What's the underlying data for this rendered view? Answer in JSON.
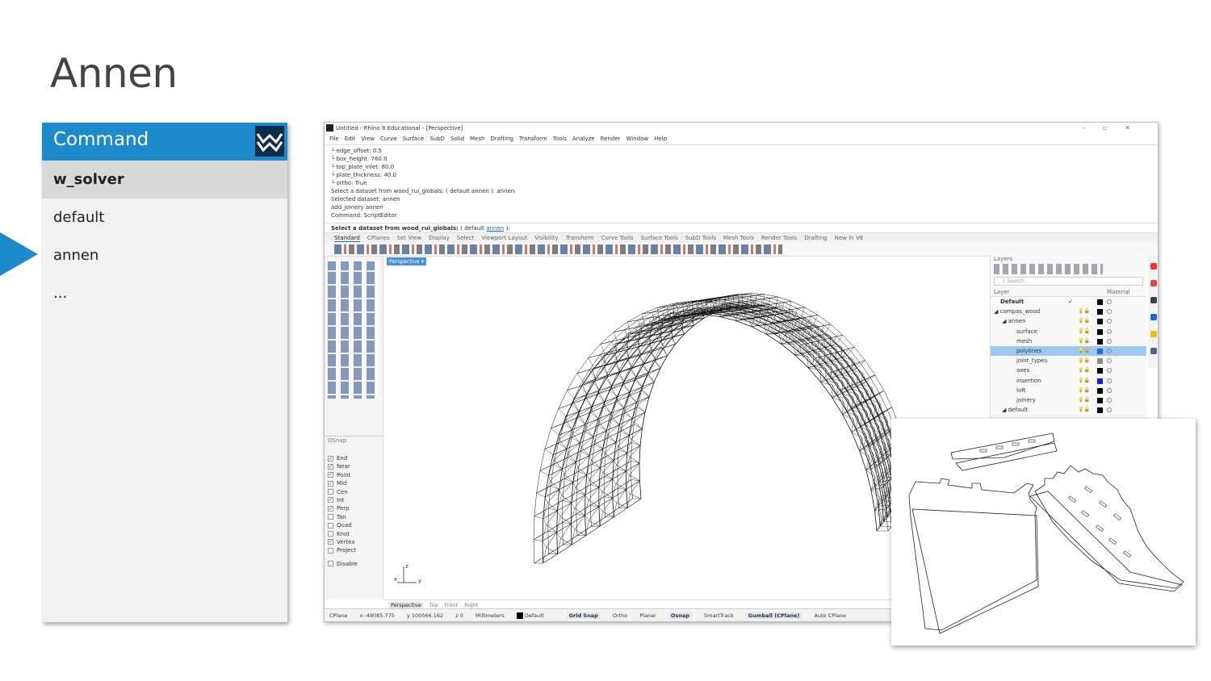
{
  "slide": {
    "title": "Annen"
  },
  "command_panel": {
    "header": "Command",
    "items": [
      "w_solver",
      "default",
      "annen",
      "..."
    ]
  },
  "rhino": {
    "window_title": "Untitled - Rhino 8 Educational - [Perspective]",
    "menu": [
      "File",
      "Edit",
      "View",
      "Curve",
      "Surface",
      "SubD",
      "Solid",
      "Mesh",
      "Drafting",
      "Transform",
      "Tools",
      "Analyze",
      "Render",
      "Window",
      "Help"
    ],
    "history": [
      "└ edge_offset: 0.5",
      "└ box_height: 760.0",
      "└ top_plate_inlet: 80.0",
      "└ plate_thickness: 40.0",
      "└ ortho: True",
      "Select a dataset from wood_rui_globals: ( default  annen ): annen",
      "Selected dataset: annen",
      "add_joinery annen",
      "Command: ScriptEditor"
    ],
    "prompt_text": "Select a dataset from wood_rui_globals:",
    "prompt_open": "( default",
    "prompt_link": "annen",
    "prompt_close": "):",
    "tabs": [
      "Standard",
      "CPlanes",
      "Set View",
      "Display",
      "Select",
      "Viewport Layout",
      "Visibility",
      "Transform",
      "Curve Tools",
      "Surface Tools",
      "SubD Tools",
      "Mesh Tools",
      "Render Tools",
      "Drafting",
      "New in V8"
    ],
    "osnap": {
      "title": "OSnap",
      "items": [
        {
          "label": "End",
          "checked": true
        },
        {
          "label": "Near",
          "checked": true
        },
        {
          "label": "Point",
          "checked": true
        },
        {
          "label": "Mid",
          "checked": true
        },
        {
          "label": "Cen",
          "checked": false
        },
        {
          "label": "Int",
          "checked": true
        },
        {
          "label": "Perp",
          "checked": true
        },
        {
          "label": "Tan",
          "checked": false
        },
        {
          "label": "Quad",
          "checked": false
        },
        {
          "label": "Knot",
          "checked": false
        },
        {
          "label": "Vertex",
          "checked": true
        },
        {
          "label": "Project",
          "checked": false
        }
      ],
      "disable": "Disable"
    },
    "viewport": {
      "label": "Perspective",
      "axis_x": "x",
      "axis_y": "y",
      "axis_z": "z",
      "bottom_tabs": [
        "Perspective",
        "Top",
        "Front",
        "Right"
      ]
    },
    "layers": {
      "title": "Layers",
      "search_placeholder": "Search",
      "col_layer": "Layer",
      "col_material": "Material",
      "rows": [
        {
          "name": "Default",
          "indent": 0,
          "bold": true,
          "color": "#000000",
          "current": true
        },
        {
          "name": "compas_wood",
          "indent": 0,
          "color": "#000000"
        },
        {
          "name": "annen",
          "indent": 1,
          "color": "#000000"
        },
        {
          "name": "surface",
          "indent": 2,
          "color": "#000000"
        },
        {
          "name": "mesh",
          "indent": 2,
          "color": "#000000"
        },
        {
          "name": "polylines",
          "indent": 2,
          "color": "#1f6fe0",
          "selected": true
        },
        {
          "name": "joint_types",
          "indent": 2,
          "color": "#888888"
        },
        {
          "name": "axes",
          "indent": 2,
          "color": "#000000"
        },
        {
          "name": "insertion",
          "indent": 2,
          "color": "#1020e0"
        },
        {
          "name": "loft",
          "indent": 2,
          "color": "#000000"
        },
        {
          "name": "joinery",
          "indent": 2,
          "color": "#000000"
        },
        {
          "name": "default",
          "indent": 1,
          "color": "#000000"
        }
      ]
    },
    "status": {
      "cplane": "CPlane",
      "x": "x -49085.775",
      "y": "y 100566.162",
      "z": "z 0",
      "units": "Millimeters",
      "layer": "Default",
      "grid_snap": "Grid Snap",
      "ortho": "Ortho",
      "planar": "Planar",
      "osnap": "Osnap",
      "smarttrack": "SmartTrack",
      "gumball": "Gumball (CPlane)",
      "auto_cplane": "Auto CPlane"
    }
  },
  "colors": {
    "accent": "#1c8acb",
    "selection": "#9cc8ef"
  }
}
